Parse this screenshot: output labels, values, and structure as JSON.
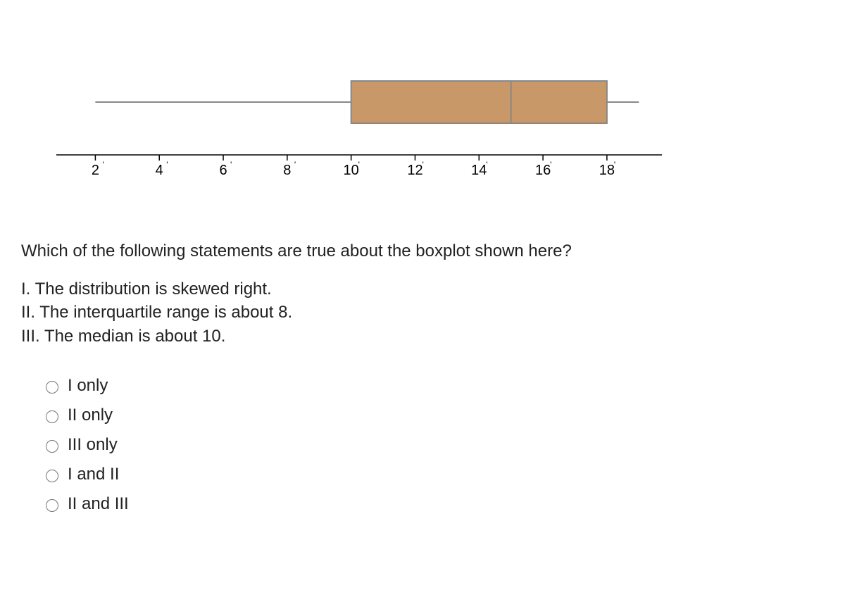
{
  "chart_data": {
    "type": "boxplot",
    "min": 2,
    "q1": 10,
    "median": 15,
    "q3": 18,
    "max": 19,
    "xlabel": "",
    "ylabel": "",
    "xlim": [
      1,
      19.5
    ],
    "ticks": [
      2,
      4,
      6,
      8,
      10,
      12,
      14,
      16,
      18
    ],
    "box_fill": "#c89868",
    "box_stroke": "#888",
    "whisker_stroke": "#888"
  },
  "question": {
    "prompt": "Which of the following statements are true about the boxplot shown here?",
    "statements": [
      "I. The distribution is skewed right.",
      "II. The interquartile range is about 8.",
      "III. The median is about 10."
    ],
    "options": [
      {
        "label": "I only"
      },
      {
        "label": "II only"
      },
      {
        "label": "III only"
      },
      {
        "label": "I and II"
      },
      {
        "label": "II and III"
      }
    ]
  }
}
